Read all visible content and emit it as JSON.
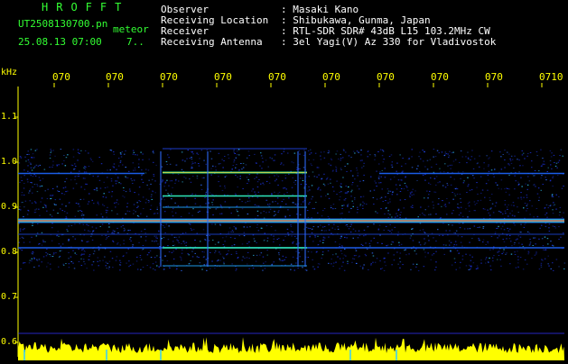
{
  "header": {
    "brand": "HROFFT",
    "file_name": "UT2508130700.pn",
    "file_tag": "meteor",
    "file_time": "25.08.13 07:00",
    "file_extra": "7..",
    "info": [
      {
        "label": "Observer",
        "value": ": Masaki Kano"
      },
      {
        "label": "Receiving Location",
        "value": ": Shibukawa, Gunma, Japan"
      },
      {
        "label": "Receiver",
        "value": ": RTL-SDR SDR# 43dB L15 103.2MHz CW"
      },
      {
        "label": "Receiving Antenna",
        "value": ": 3el Yagi(V) Az 330 for Vladivostok"
      }
    ]
  },
  "axis": {
    "y_unit": "kHz",
    "y_ticks": [
      "1.1",
      "1.0",
      "0.9",
      "0.8",
      "0.7",
      "0.6"
    ],
    "x_ticks": [
      "070",
      "070",
      "070",
      "070",
      "070",
      "070",
      "070",
      "070",
      "070",
      "0710"
    ]
  },
  "colors": {
    "background": "#000000",
    "text_info": "#ffffff",
    "text_brand": "#33ff33",
    "axis": "#ffff00",
    "carrier": "#ff3333",
    "signal": "#33ff99",
    "noise": "#2244ff",
    "power_trace": "#ffff00"
  }
}
